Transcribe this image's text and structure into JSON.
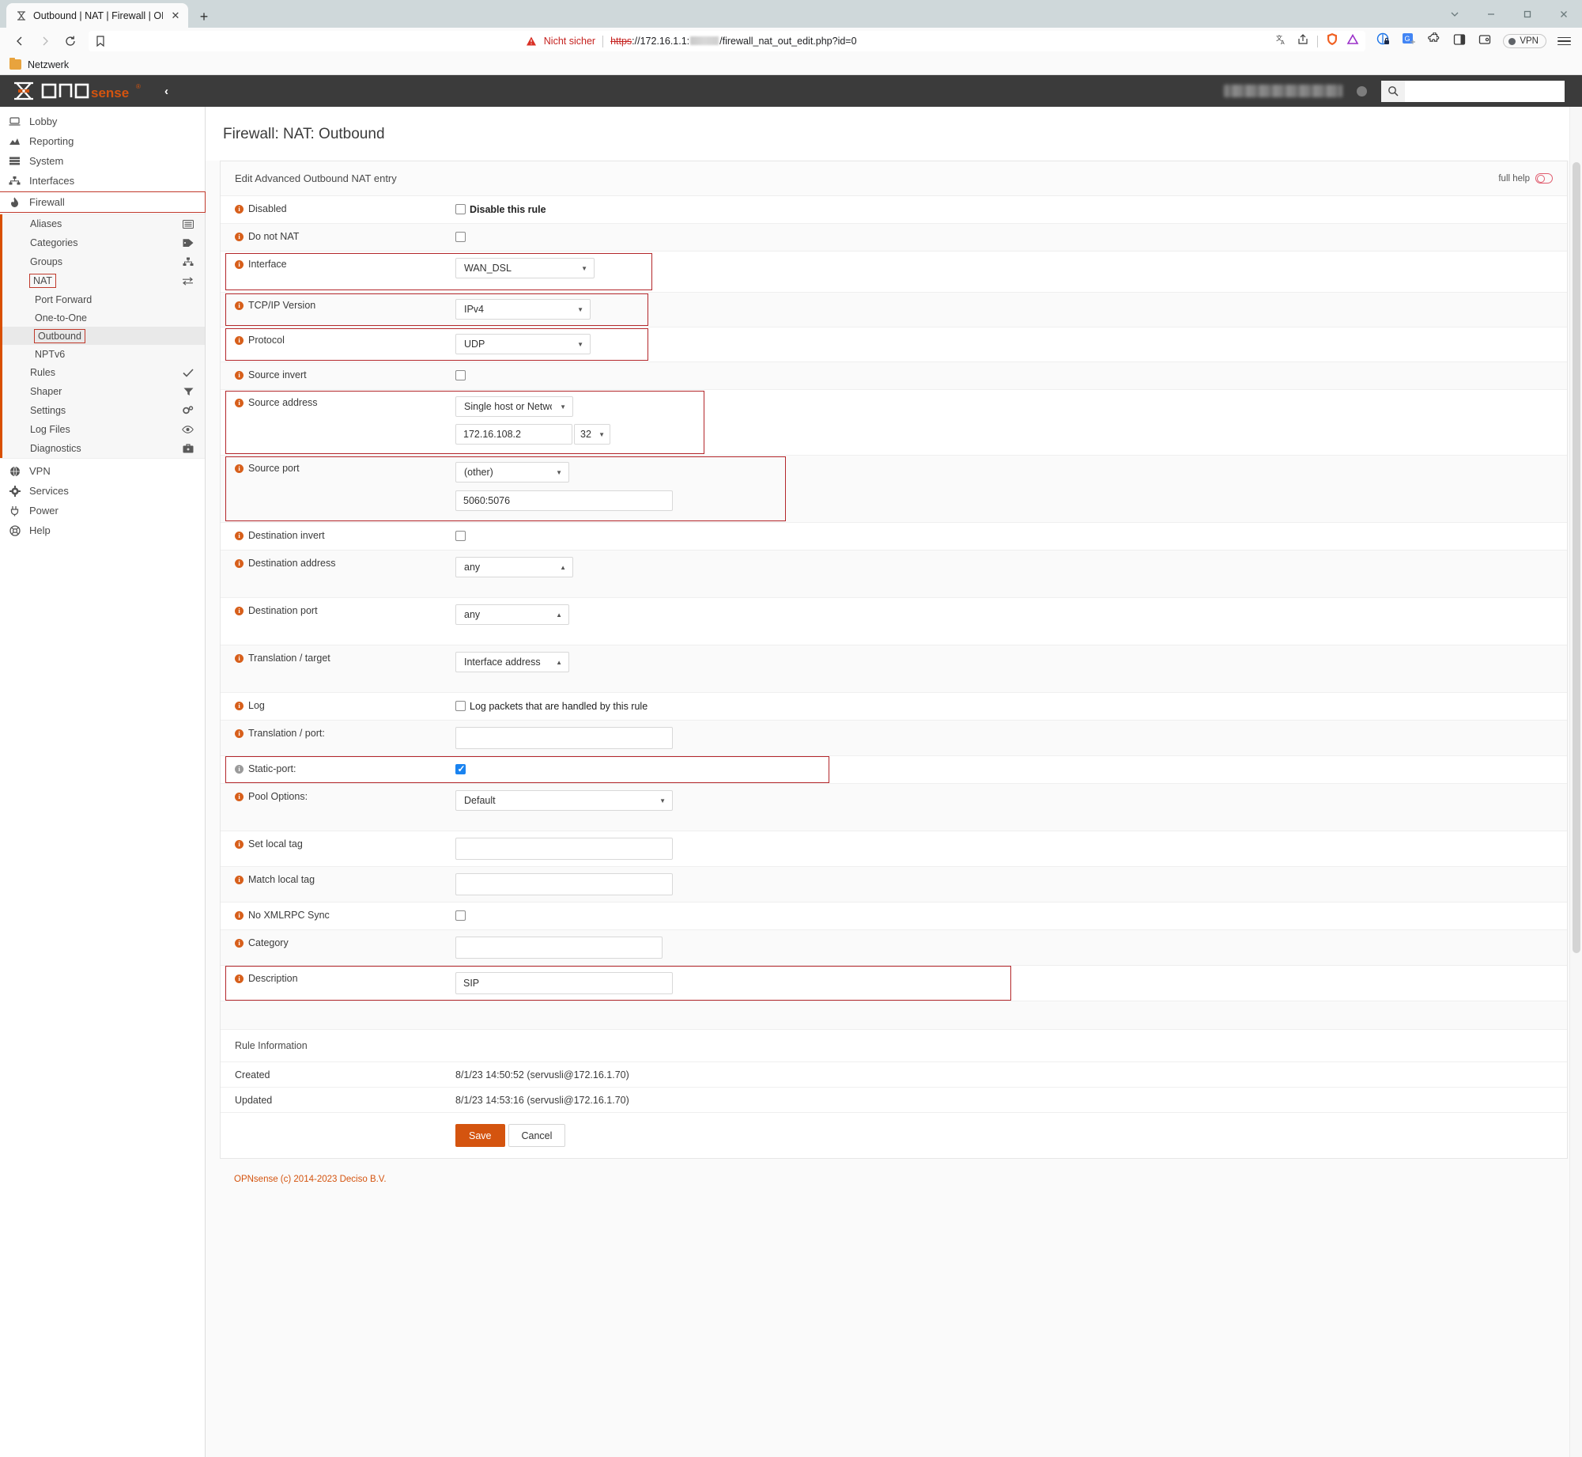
{
  "browser": {
    "tab_title": "Outbound | NAT | Firewall | OPNs",
    "tab_close_glyph": "✕",
    "newtab_glyph": "+",
    "security_label": "Nicht sicher",
    "url_scheme": "https",
    "url_rest": "://172.16.1.1:",
    "url_tail": "/firewall_nat_out_edit.php?id=0",
    "bookmark_folder": "Netzwerk",
    "vpn_label": "VPN",
    "window_controls": [
      "chevron-down",
      "minimize",
      "maximize",
      "close"
    ]
  },
  "topbar": {
    "logo_text_a": "OPN",
    "logo_text_b": "sense",
    "logo_reg": "®",
    "collapse_glyph": "‹",
    "search_placeholder": ""
  },
  "sidebar": {
    "items": [
      {
        "label": "Lobby",
        "icon": "laptop-icon"
      },
      {
        "label": "Reporting",
        "icon": "chart-icon"
      },
      {
        "label": "System",
        "icon": "server-icon"
      },
      {
        "label": "Interfaces",
        "icon": "sitemap-icon"
      },
      {
        "label": "Firewall",
        "icon": "fire-icon",
        "highlighted": true
      }
    ],
    "firewall_children": [
      {
        "label": "Aliases",
        "icon": "list-alt-icon"
      },
      {
        "label": "Categories",
        "icon": "tag-icon"
      },
      {
        "label": "Groups",
        "icon": "sitemap-icon"
      },
      {
        "label": "NAT",
        "icon": "exchange-icon",
        "highlighted": true
      }
    ],
    "nat_children": [
      {
        "label": "Port Forward"
      },
      {
        "label": "One-to-One"
      },
      {
        "label": "Outbound",
        "selected": true,
        "highlighted": true
      },
      {
        "label": "NPTv6"
      }
    ],
    "firewall_children_after": [
      {
        "label": "Rules",
        "icon": "check-icon"
      },
      {
        "label": "Shaper",
        "icon": "filter-icon"
      },
      {
        "label": "Settings",
        "icon": "gears-icon"
      },
      {
        "label": "Log Files",
        "icon": "eye-icon"
      },
      {
        "label": "Diagnostics",
        "icon": "briefcase-icon"
      }
    ],
    "items_bottom": [
      {
        "label": "VPN",
        "icon": "globe-icon"
      },
      {
        "label": "Services",
        "icon": "gear-icon"
      },
      {
        "label": "Power",
        "icon": "plug-icon"
      },
      {
        "label": "Help",
        "icon": "lifering-icon"
      }
    ]
  },
  "page": {
    "title": "Firewall: NAT: Outbound",
    "card_header": "Edit Advanced Outbound NAT entry",
    "full_help_label": "full help"
  },
  "form": {
    "disabled": {
      "label": "Disabled",
      "checkbox_label": "Disable this rule",
      "checked": false
    },
    "do_not_nat": {
      "label": "Do not NAT",
      "checked": false
    },
    "interface": {
      "label": "Interface",
      "value": "WAN_DSL"
    },
    "tcpip_version": {
      "label": "TCP/IP Version",
      "value": "IPv4"
    },
    "protocol": {
      "label": "Protocol",
      "value": "UDP"
    },
    "source_invert": {
      "label": "Source invert",
      "checked": false
    },
    "source_address": {
      "label": "Source address",
      "type_value": "Single host or Network",
      "address": "172.16.108.2",
      "mask": "32"
    },
    "source_port": {
      "label": "Source port",
      "type_value": "(other)",
      "port_value": "5060:5076"
    },
    "destination_invert": {
      "label": "Destination invert",
      "checked": false
    },
    "destination_address": {
      "label": "Destination address",
      "value": "any"
    },
    "destination_port": {
      "label": "Destination port",
      "value": "any"
    },
    "translation_target": {
      "label": "Translation / target",
      "value": "Interface address"
    },
    "log": {
      "label": "Log",
      "checkbox_label": "Log packets that are handled by this rule",
      "checked": false
    },
    "translation_port": {
      "label": "Translation / port:",
      "value": ""
    },
    "static_port": {
      "label": "Static-port:",
      "checked": true
    },
    "pool_options": {
      "label": "Pool Options:",
      "value": "Default"
    },
    "set_local_tag": {
      "label": "Set local tag",
      "value": ""
    },
    "match_local_tag": {
      "label": "Match local tag",
      "value": ""
    },
    "no_xmlrpc_sync": {
      "label": "No XMLRPC Sync",
      "checked": false
    },
    "category": {
      "label": "Category",
      "value": ""
    },
    "description": {
      "label": "Description",
      "value": "SIP"
    }
  },
  "rule_information": {
    "header": "Rule Information",
    "created_label": "Created",
    "created_value": "8/1/23 14:50:52 (servusli@172.16.1.70)",
    "updated_label": "Updated",
    "updated_value": "8/1/23 14:53:16 (servusli@172.16.1.70)"
  },
  "actions": {
    "save_label": "Save",
    "cancel_label": "Cancel"
  },
  "footer": {
    "text": "OPNsense (c) 2014-2023 Deciso B.V."
  },
  "colors": {
    "accent_orange": "#d4540f",
    "highlight_red": "#b3262a",
    "topbar_dark": "#3b3b3b",
    "checkbox_blue": "#1a83f0"
  }
}
